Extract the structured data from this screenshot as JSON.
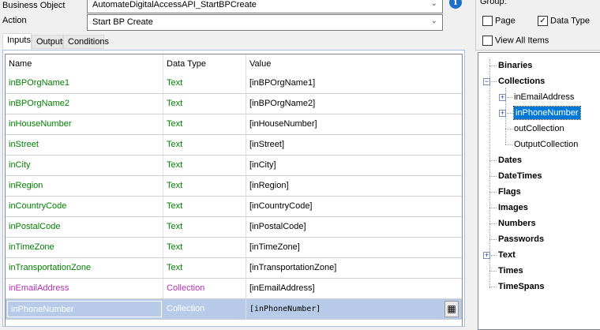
{
  "form": {
    "business_object_label": "Business Object",
    "business_object_value": "AutomateDigitalAccessAPI_StartBPCreate",
    "action_label": "Action",
    "action_value": "Start BP Create"
  },
  "tabs": [
    {
      "label": "Inputs",
      "active": true
    },
    {
      "label": "Outputs"
    },
    {
      "label": "Conditions"
    }
  ],
  "grid": {
    "headers": [
      "Name",
      "Data Type",
      "Value"
    ],
    "rows": [
      {
        "name": "inBPOrgName1",
        "type": "Text",
        "value": "[inBPOrgName1]"
      },
      {
        "name": "inBPOrgName2",
        "type": "Text",
        "value": "[inBPOrgName2]"
      },
      {
        "name": "inHouseNumber",
        "type": "Text",
        "value": "[inHouseNumber]"
      },
      {
        "name": "inStreet",
        "type": "Text",
        "value": "[inStreet]"
      },
      {
        "name": "inCity",
        "type": "Text",
        "value": "[inCity]"
      },
      {
        "name": "inRegion",
        "type": "Text",
        "value": "[inRegion]"
      },
      {
        "name": "inCountryCode",
        "type": "Text",
        "value": "[inCountryCode]"
      },
      {
        "name": "inPostalCode",
        "type": "Text",
        "value": "[inPostalCode]"
      },
      {
        "name": "inTimeZone",
        "type": "Text",
        "value": "[inTimeZone]"
      },
      {
        "name": "inTransportationZone",
        "type": "Text",
        "value": "[inTransportationZone]"
      },
      {
        "name": "inEmailAddress",
        "type": "Collection",
        "value": "[inEmailAddress]"
      },
      {
        "name": "inPhoneNumber",
        "type": "Collection",
        "value": "[inPhoneNumber]",
        "selected": true
      }
    ]
  },
  "colors": {
    "text_type": "#008000",
    "collection_type": "#b030b0",
    "selected_row": "#b7cbe8",
    "tree_selected": "#0078d7"
  },
  "group": {
    "label": "Group:",
    "page": "Page",
    "page_checked": false,
    "data_type": "Data Type",
    "data_type_checked": true,
    "view_all": "View All Items",
    "view_all_checked": false
  },
  "tree": {
    "binaries": "Binaries",
    "collections": "Collections",
    "collection_children": [
      "inEmailAddress",
      "inPhoneNumber",
      "outCollection",
      "OutputCollection"
    ],
    "rest": [
      "Dates",
      "DateTimes",
      "Flags",
      "Images",
      "Numbers",
      "Passwords",
      "Text",
      "Times",
      "TimeSpans"
    ]
  }
}
